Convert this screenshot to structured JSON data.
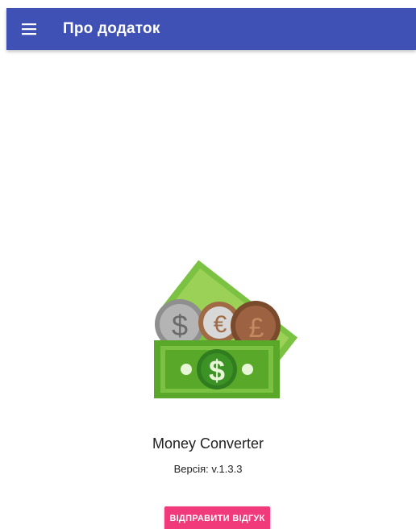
{
  "app_bar": {
    "menu_icon": "hamburger-menu-icon",
    "title": "Про додаток",
    "color": "#3f51b5"
  },
  "about": {
    "logo_icon": "money-converter-logo",
    "app_name": "Money Converter",
    "version_text": "Версія: v.1.3.3"
  },
  "feedback": {
    "label": "ВІДПРАВИТИ ВІДГУК",
    "color": "#f03a7a"
  }
}
